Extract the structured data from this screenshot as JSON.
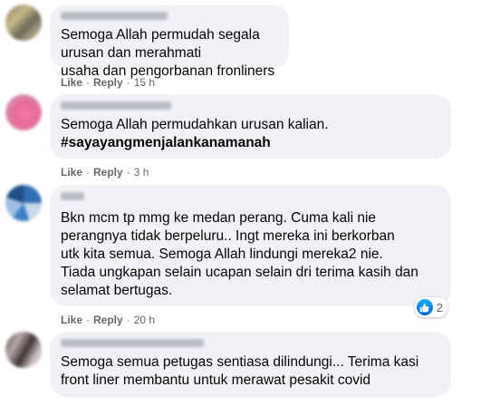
{
  "comments": [
    {
      "text": "Semoga Allah permudah segala urusan dan merahmati\nusaha dan pengorbanan fronliners",
      "hashtag": "",
      "like_label": "Like",
      "reply_label": "Reply",
      "separator": "·",
      "time": "15 h"
    },
    {
      "text": "Semoga Allah permudahkan urusan kalian.",
      "hashtag": "#sayayangmenjalankanamanah",
      "like_label": "Like",
      "reply_label": "Reply",
      "separator": "·",
      "time": "3 h"
    },
    {
      "text": "Bkn mcm tp mmg ke medan perang. Cuma kali nie\nperangnya tidak berpeluru.. Ingt mereka ini berkorban\nutk kita semua. Semoga Allah lindungi mereka2 nie.\nTiada ungkapan selain ucapan selain dri terima kasih dan\nselamat bertugas.",
      "hashtag": "",
      "like_label": "Like",
      "reply_label": "Reply",
      "separator": "·",
      "time": "20 h",
      "reaction_count": "2",
      "reaction_icon": "like-reaction-icon"
    },
    {
      "text": "Semoga semua petugas sentiasa dilindungi... Terima kasi\nfront liner membantu untuk merawat pesakit covid",
      "hashtag": ""
    }
  ],
  "colors": {
    "bubble": "#f0f2f5",
    "meta_text": "#65676b",
    "like_blue": "#1877f2"
  }
}
